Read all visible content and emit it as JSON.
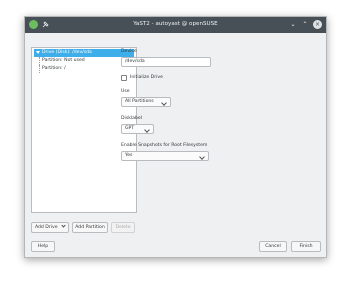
{
  "window": {
    "title": "YaST2 - autoyast @ openSUSE",
    "controls": {
      "minimize": "⌄",
      "maximize": "⌃",
      "close": "×"
    }
  },
  "tree": {
    "selected": "Drive (Disk): /dev/sda",
    "children": [
      "Partition: Not used",
      "Partition: /"
    ]
  },
  "details": {
    "device_label": "Device",
    "device_value": "/dev/sda",
    "initialize_label": "Initialize Drive",
    "use_label": "Use",
    "use_value": "All Partitions",
    "disklabel_label": "Disklabel",
    "disklabel_value": "GPT",
    "snapshots_label": "Enable Snapshots for Root Filesystem",
    "snapshots_value": "Yes"
  },
  "buttons": {
    "add_drive": "Add Drive",
    "add_partition": "Add Partition",
    "delete": "Delete",
    "help": "Help",
    "cancel": "Cancel",
    "finish": "Finish"
  },
  "colors": {
    "titlebar": "#475057",
    "selection": "#3daee9",
    "window_bg": "#eff0f1"
  }
}
